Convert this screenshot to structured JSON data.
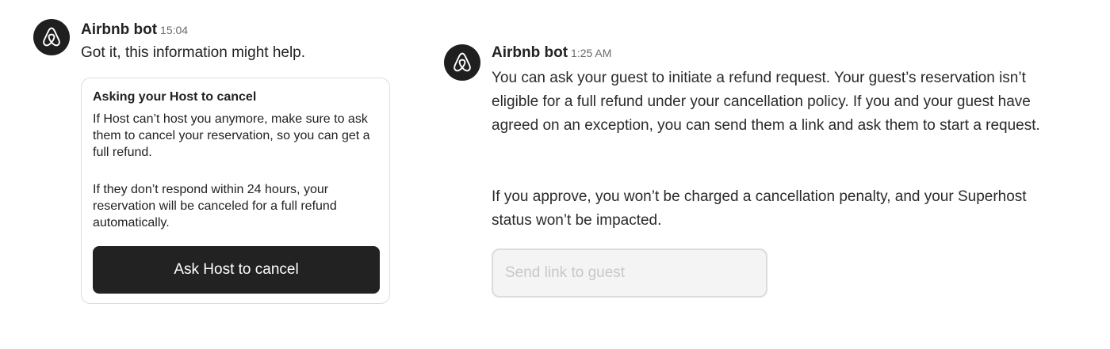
{
  "left_message": {
    "sender": "Airbnb bot",
    "time": "15:04",
    "text": "Got it, this information might help.",
    "card": {
      "title": "Asking your Host to cancel",
      "paragraph1": "If Host can’t host you anymore, make sure to ask them to cancel your reservation, so you can get a full refund.",
      "paragraph2": "If they don’t respond within 24 hours, your reservation will be canceled for a full refund automatically.",
      "button_label": "Ask Host to cancel"
    }
  },
  "right_message": {
    "sender": "Airbnb bot",
    "time": "1:25 AM",
    "paragraph1": "You can ask your guest to initiate a refund request. Your guest’s reservation isn’t eligible for a full refund under your cancellation policy. If you and your guest have agreed on an exception, you can send them a link and ask them to start a request.",
    "paragraph2": "If you approve, you won’t be charged a cancellation penalty, and your Superhost status won’t be impacted.",
    "button_label": "Send link to guest",
    "button_state": "disabled"
  },
  "icons": {
    "avatar": "airbnb-logo-icon"
  },
  "colors": {
    "avatar_bg": "#1f1f1f",
    "primary_button": "#222222",
    "disabled_button_bg": "#f4f4f4",
    "disabled_button_text": "#c8c8c8"
  }
}
